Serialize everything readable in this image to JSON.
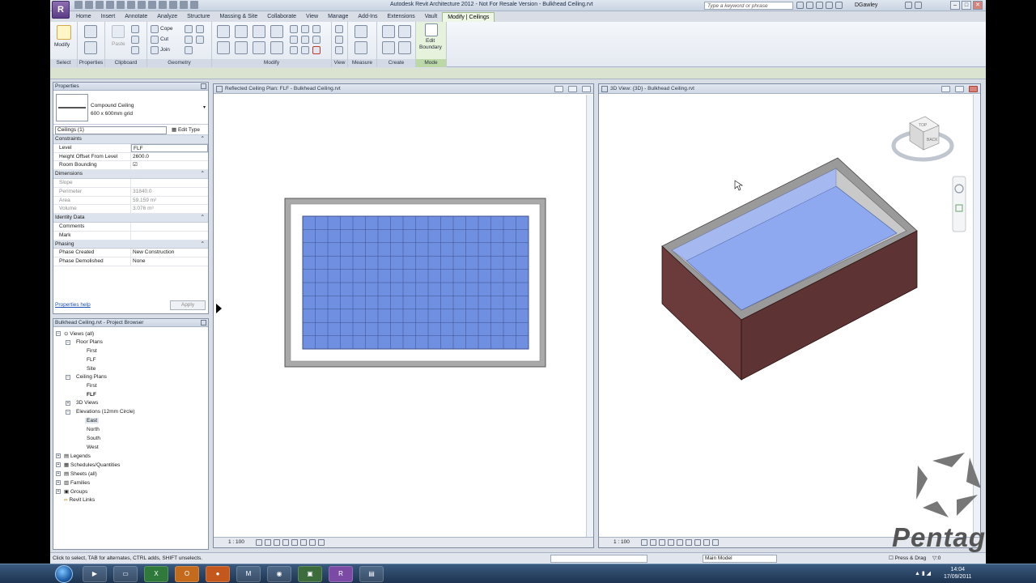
{
  "window": {
    "app_button": "R",
    "title": "Autodesk Revit Architecture 2012 - Not For Resale Version -    Bulkhead Ceiling.rvt",
    "search_placeholder": "Type a keyword or phrase",
    "user": "DGawley"
  },
  "ribbon": {
    "tabs": [
      {
        "label": "Home"
      },
      {
        "label": "Insert"
      },
      {
        "label": "Annotate"
      },
      {
        "label": "Analyze"
      },
      {
        "label": "Structure"
      },
      {
        "label": "Massing & Site"
      },
      {
        "label": "Collaborate"
      },
      {
        "label": "View"
      },
      {
        "label": "Manage"
      },
      {
        "label": "Add-Ins"
      },
      {
        "label": "Extensions"
      },
      {
        "label": "Vault"
      },
      {
        "label": "Modify | Ceilings"
      }
    ],
    "active_tab": "Modify | Ceilings",
    "panels": {
      "select": "Select",
      "properties": "Properties",
      "clipboard": "Clipboard",
      "geometry": "Geometry",
      "modify": "Modify",
      "view": "View",
      "measure": "Measure",
      "create": "Create",
      "mode": "Mode"
    },
    "tools": {
      "modify": "Modify",
      "paste": "Paste",
      "cope": "Cope",
      "cut": "Cut",
      "join": "Join",
      "edit_boundary_1": "Edit",
      "edit_boundary_2": "Boundary"
    }
  },
  "properties": {
    "header": "Properties",
    "type_name": "Compound Ceiling",
    "type_sub": "600 x 600mm grid",
    "instance_selector": "Ceilings (1)",
    "edit_type": "Edit Type",
    "sections": [
      {
        "label": "Constraints",
        "rows": [
          {
            "key": "Level",
            "value": "FLF",
            "grey": false
          },
          {
            "key": "Height Offset From Level",
            "value": "2600.0",
            "grey": false
          },
          {
            "key": "Room Bounding",
            "value": "☑",
            "grey": false
          }
        ]
      },
      {
        "label": "Dimensions",
        "rows": [
          {
            "key": "Slope",
            "value": "",
            "grey": true
          },
          {
            "key": "Perimeter",
            "value": "31840.0",
            "grey": true
          },
          {
            "key": "Area",
            "value": "59.159 m²",
            "grey": true
          },
          {
            "key": "Volume",
            "value": "3.076 m³",
            "grey": true
          }
        ]
      },
      {
        "label": "Identity Data",
        "rows": [
          {
            "key": "Comments",
            "value": "",
            "grey": false
          },
          {
            "key": "Mark",
            "value": "",
            "grey": false
          }
        ]
      },
      {
        "label": "Phasing",
        "rows": [
          {
            "key": "Phase Created",
            "value": "New Construction",
            "grey": false
          },
          {
            "key": "Phase Demolished",
            "value": "None",
            "grey": false
          }
        ]
      }
    ],
    "help_link": "Properties help",
    "apply": "Apply"
  },
  "browser": {
    "header": "Bulkhead Ceiling.rvt - Project Browser",
    "views_all": "Views (all)",
    "floor_plans": "Floor Plans",
    "fp_first": "First",
    "fp_flf": "FLF",
    "fp_site": "Site",
    "ceiling_plans": "Ceiling Plans",
    "cp_first": "First",
    "cp_flf": "FLF",
    "views_3d": "3D Views",
    "elevations": "Elevations (12mm Circle)",
    "el_east": "East",
    "el_north": "North",
    "el_south": "South",
    "el_west": "West",
    "legends": "Legends",
    "schedules": "Schedules/Quantities",
    "sheets": "Sheets (all)",
    "families": "Families",
    "groups": "Groups",
    "revit_links": "Revit Links"
  },
  "views": {
    "rcp_title": "Reflected Ceiling Plan: FLF - Bulkhead Ceiling.rvt",
    "rcp_scale": "1 : 100",
    "v3d_title": "3D View: {3D} - Bulkhead Ceiling.rvt",
    "v3d_scale": "1 : 100",
    "viewcube_top": "TOP",
    "viewcube_back": "BACK"
  },
  "status": {
    "text": "Click to select, TAB for alternates, CTRL adds, SHIFT unselects.",
    "model": "Main Model",
    "press_drag": "Press & Drag",
    "filter": ":0"
  },
  "taskbar": {
    "time": "14:04",
    "date": "17/09/2011"
  },
  "watermark": {
    "text": "Pentagon"
  },
  "colors": {
    "ceiling_blue": "#6f8fe0",
    "wall_grey": "#a8a8a8",
    "wall_side": "#6b3b3b",
    "ribbon_active": "#eef6e6"
  }
}
